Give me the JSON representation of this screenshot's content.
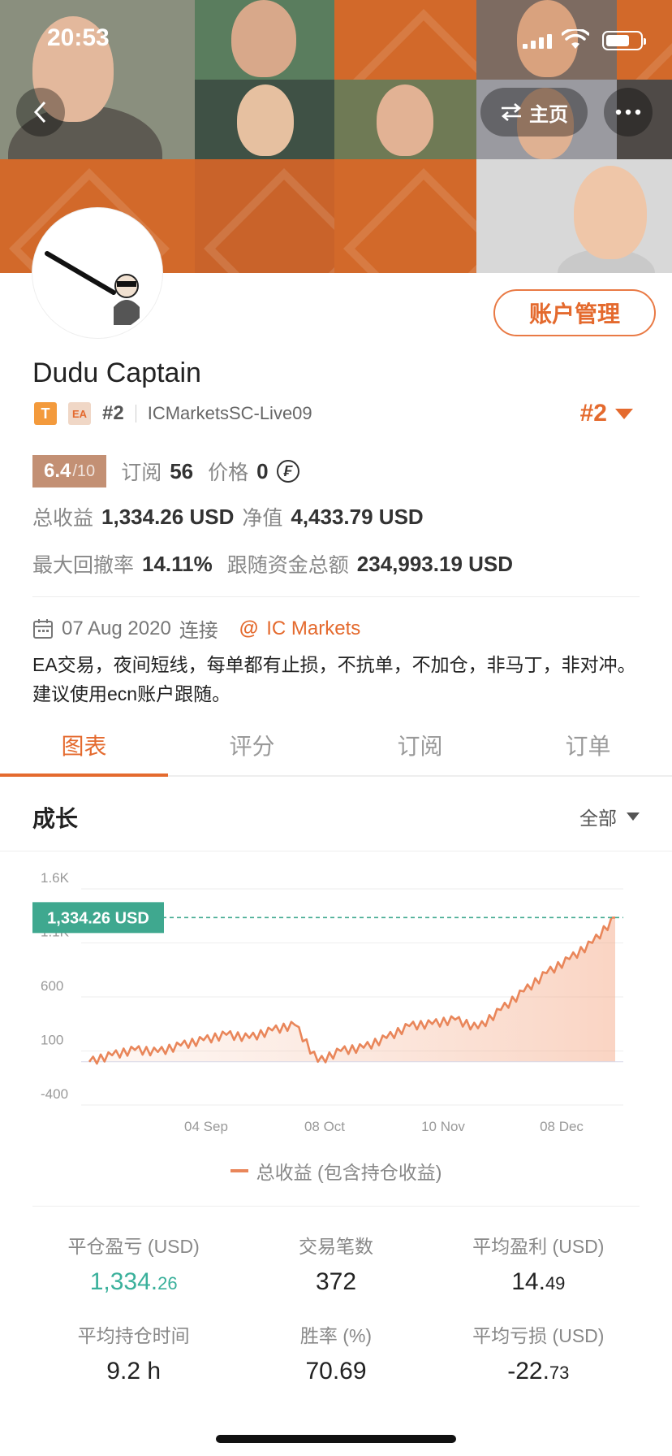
{
  "status_bar": {
    "time": "20:53"
  },
  "nav": {
    "home_label": "主页"
  },
  "profile": {
    "name": "Dudu Captain",
    "tag_t": "T",
    "tag_ea": "EA",
    "rank": "#2",
    "server": "ICMarketsSC-Live09",
    "rank_dropdown": "#2",
    "manage_label": "账户管理"
  },
  "score": {
    "value": "6.4",
    "max": "/10"
  },
  "stats": {
    "subscribe_label": "订阅",
    "subscribe_value": "56",
    "price_label": "价格",
    "price_value": "0",
    "currency_symbol": "₣",
    "total_profit_label": "总收益",
    "total_profit_value": "1,334.26 USD",
    "equity_label": "净值",
    "equity_value": "4,433.79 USD",
    "max_drawdown_label": "最大回撤率",
    "max_drawdown_value": "14.11%",
    "follow_funds_label": "跟随资金总额",
    "follow_funds_value": "234,993.19 USD"
  },
  "meta": {
    "date": "07 Aug 2020",
    "connect_label": "连接",
    "at": "@",
    "broker": "IC Markets",
    "description": "EA交易，夜间短线，每单都有止损，不抗单，不加仓，非马丁，非对冲。建议使用ecn账户跟随。"
  },
  "tabs": [
    {
      "label": "图表",
      "active": true
    },
    {
      "label": "评分",
      "active": false
    },
    {
      "label": "订阅",
      "active": false
    },
    {
      "label": "订单",
      "active": false
    }
  ],
  "growth": {
    "title": "成长",
    "filter": "全部"
  },
  "chart_data": {
    "type": "area",
    "y_ticks": [
      "1.6K",
      "1.1K",
      "600",
      "100",
      "-400"
    ],
    "ylim": [
      -400,
      1600
    ],
    "x_ticks": [
      "04 Sep",
      "08 Oct",
      "10 Nov",
      "08 Dec"
    ],
    "current_label": "1,334.26 USD",
    "current_value": 1334.26,
    "series": [
      {
        "name": "总收益 (包含持仓收益)",
        "color": "#e9865a",
        "x": [
          "07 Aug",
          "14 Aug",
          "21 Aug",
          "28 Aug",
          "04 Sep",
          "11 Sep",
          "18 Sep",
          "25 Sep",
          "02 Oct",
          "08 Oct",
          "11 Oct",
          "18 Oct",
          "25 Oct",
          "01 Nov",
          "05 Nov",
          "10 Nov",
          "17 Nov",
          "24 Nov",
          "01 Dec",
          "08 Dec",
          "12 Dec",
          "15 Dec",
          "17 Dec",
          "18 Dec"
        ],
        "values": [
          0,
          60,
          110,
          90,
          150,
          200,
          250,
          220,
          290,
          340,
          0,
          100,
          130,
          220,
          330,
          350,
          390,
          310,
          480,
          650,
          820,
          950,
          1100,
          1334.26
        ]
      }
    ]
  },
  "legend": {
    "label": "总收益 (包含持仓收益)"
  },
  "summary": [
    {
      "label": "平仓盈亏 (USD)",
      "value_main": "1,334.",
      "value_small": "26",
      "green": true
    },
    {
      "label": "交易笔数",
      "value_main": "372",
      "value_small": "",
      "green": false
    },
    {
      "label": "平均盈利 (USD)",
      "value_main": "14.",
      "value_small": "49",
      "green": false
    },
    {
      "label": "平均持仓时间",
      "value_main": "9.2 h",
      "value_small": "",
      "green": false
    },
    {
      "label": "胜率 (%)",
      "value_main": "70.69",
      "value_small": "",
      "green": false
    },
    {
      "label": "平均亏损 (USD)",
      "value_main": "-22.",
      "value_small": "73",
      "green": false
    }
  ]
}
